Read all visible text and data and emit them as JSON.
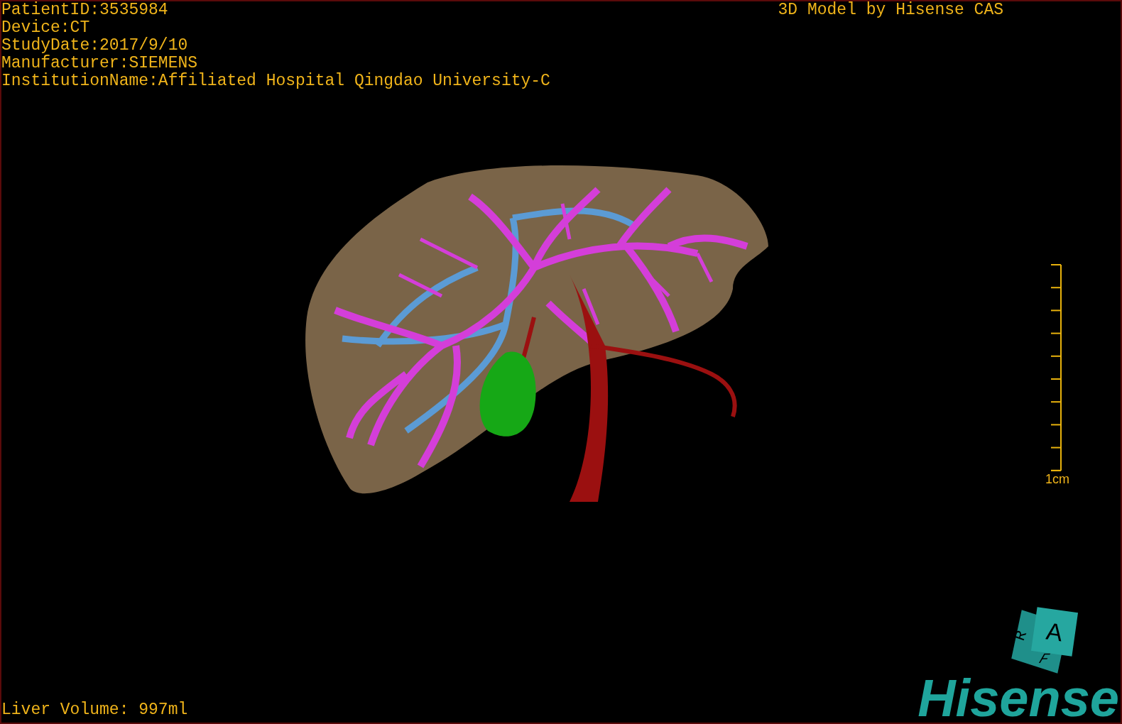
{
  "info_lines": [
    "PatientID:3535984",
    "Device:CT",
    "StudyDate:2017/9/10",
    "Manufacturer:SIEMENS",
    "InstitutionName:Affiliated Hospital Qingdao University-C"
  ],
  "title": "3D Model by Hisense CAS",
  "scale_bar": {
    "label": "1cm"
  },
  "volume": "Liver Volume: 997ml",
  "orientation_cube": {
    "front": "A",
    "side": "R",
    "bottom": "F"
  },
  "logo": "Hisense"
}
